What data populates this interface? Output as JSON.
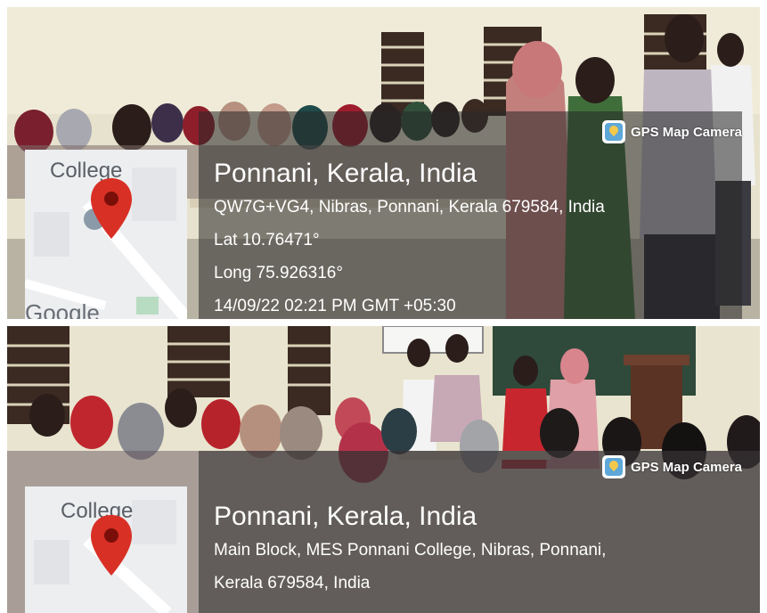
{
  "photo1": {
    "app_label": "GPS Map Camera",
    "map": {
      "college_label": "College",
      "google_label": "Google"
    },
    "city": "Ponnani, Kerala, India",
    "address": "QW7G+VG4, Nibras, Ponnani, Kerala 679584, India",
    "lat": "Lat 10.76471°",
    "long": "Long 75.926316°",
    "datetime": "14/09/22 02:21 PM GMT +05:30"
  },
  "photo2": {
    "app_label": "GPS Map Camera",
    "map": {
      "college_label": "College"
    },
    "city": "Ponnani, Kerala, India",
    "address_line1": "Main Block, MES Ponnani College, Nibras, Ponnani,",
    "address_line2": "Kerala 679584, India"
  },
  "colors": {
    "overlay": "#282828",
    "pin": "#d93025",
    "wall": "#e9e4cf",
    "window": "#3a2a22"
  },
  "icons": [
    "gps-map-camera-icon",
    "map-pin-icon"
  ]
}
